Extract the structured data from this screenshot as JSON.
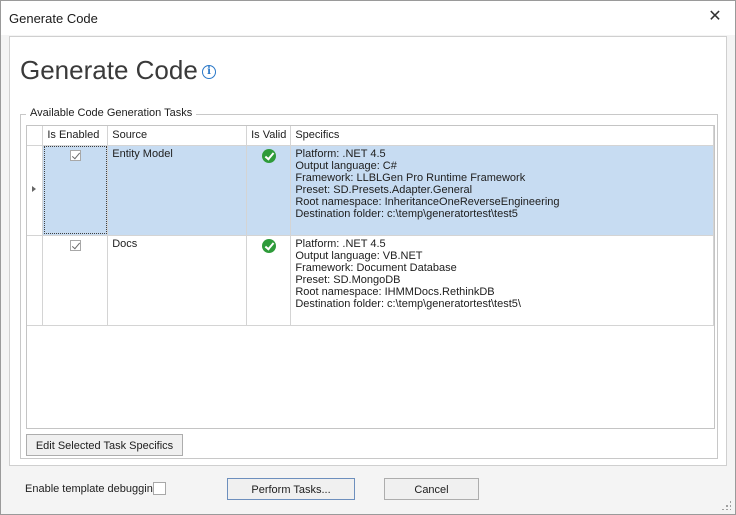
{
  "window": {
    "title": "Generate Code"
  },
  "header": {
    "title": "Generate Code"
  },
  "group": {
    "legend": "Available Code Generation Tasks"
  },
  "grid": {
    "columns": [
      "Is Enabled",
      "Source",
      "Is Valid",
      "Specifics"
    ],
    "rows": [
      {
        "enabled": true,
        "source": "Entity Model",
        "valid": true,
        "specifics": [
          "Platform: .NET 4.5",
          "Output language: C#",
          "Framework: LLBLGen Pro Runtime Framework",
          "Preset: SD.Presets.Adapter.General",
          "Root namespace: InheritanceOneReverseEngineering",
          "Destination folder: c:\\temp\\generatortest\\test5"
        ]
      },
      {
        "enabled": true,
        "source": "Docs",
        "valid": true,
        "specifics": [
          "Platform: .NET 4.5",
          "Output language: VB.NET",
          "Framework: Document Database",
          "Preset: SD.MongoDB",
          "Root namespace: IHMMDocs.RethinkDB",
          "Destination folder: c:\\temp\\generatortest\\test5\\"
        ]
      }
    ]
  },
  "buttons": {
    "edit_specifics": "Edit Selected Task Specifics",
    "perform": "Perform Tasks...",
    "cancel": "Cancel"
  },
  "options": {
    "template_debugging_label": "Enable template debugging",
    "template_debugging_checked": false
  },
  "colors": {
    "selection": "#c7dcf2",
    "valid_green": "#2e9b3a",
    "info_blue": "#2a78c8"
  }
}
